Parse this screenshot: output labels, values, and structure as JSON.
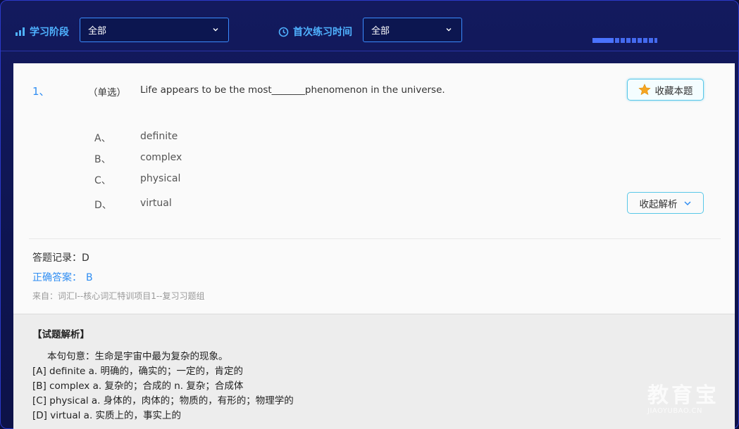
{
  "filters": {
    "stage_label": "学习阶段",
    "stage_value": "全部",
    "time_label": "首次练习时间",
    "time_value": "全部"
  },
  "question": {
    "number": "1、",
    "type": "（单选）",
    "text": "Life appears to be the most_______phenomenon in the universe.",
    "favorite_label": "收藏本题",
    "options": [
      {
        "key": "A、",
        "value": "definite"
      },
      {
        "key": "B、",
        "value": "complex"
      },
      {
        "key": "C、",
        "value": "physical"
      },
      {
        "key": "D、",
        "value": "virtual"
      }
    ],
    "collapse_label": "收起解析"
  },
  "result": {
    "record": "答题记录：D",
    "correct_label": "正确答案：",
    "correct_value": "B",
    "source": "来自：词汇I--核心词汇特训项目1--复习习题组"
  },
  "analysis": {
    "title": "【试题解析】",
    "lines": [
      "本句句意：生命是宇宙中最为复杂的现象。",
      "[A] definite a. 明确的，确实的；一定的，肯定的",
      "[B] complex a. 复杂的；合成的 n. 复杂；合成体",
      "[C] physical a. 身体的，肉体的；物质的，有形的；物理学的",
      "[D] virtual a. 实质上的，事实上的"
    ]
  },
  "watermark": {
    "cn": "教育宝",
    "en": "JIAOYUBAO.CN"
  },
  "icons": {
    "stage": "bar-chart-icon",
    "time": "clock-icon",
    "favorite": "star-icon",
    "collapse": "chevron-down-icon"
  },
  "colors": {
    "accent": "#2f8df2",
    "label_blue": "#4fb2ff",
    "button_border": "#58c7e8",
    "star": "#f5a623",
    "background": "#0e1450"
  }
}
